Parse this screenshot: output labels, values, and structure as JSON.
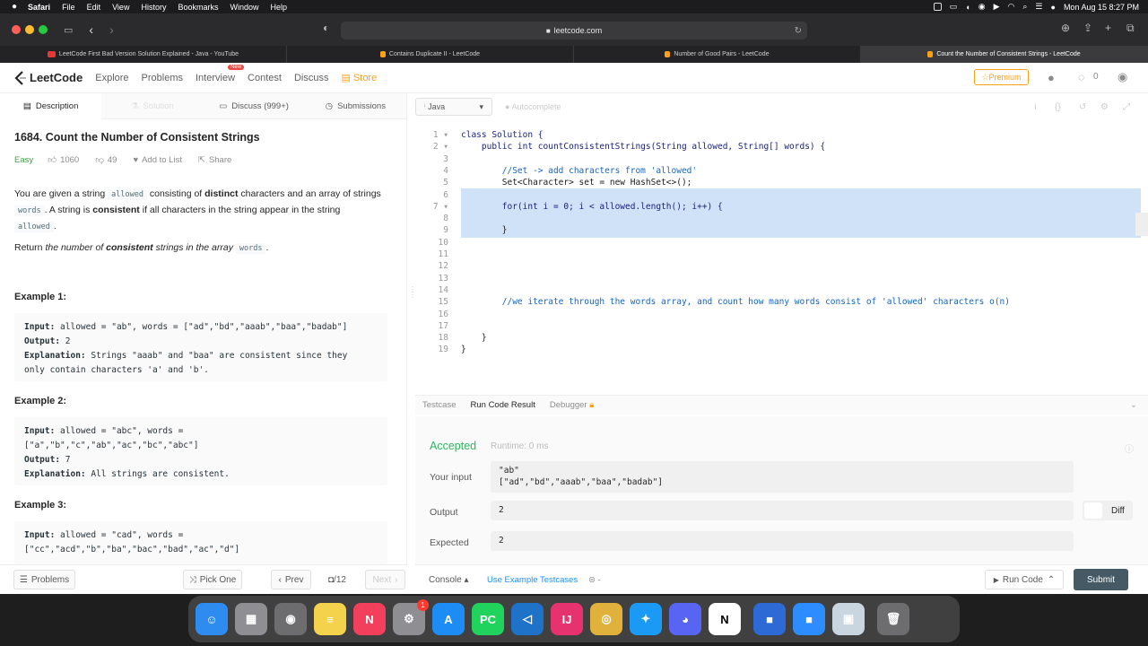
{
  "menubar": {
    "app": "Safari",
    "items": [
      "File",
      "Edit",
      "View",
      "History",
      "Bookmarks",
      "Window",
      "Help"
    ],
    "clock": "Mon Aug 15  8:27 PM"
  },
  "browser": {
    "url": "leetcode.com",
    "tabs": [
      {
        "title": "LeetCode First Bad Version Solution Explained - Java - YouTube",
        "color": "#e53935"
      },
      {
        "title": "Contains Duplicate II - LeetCode",
        "color": "#ffa116"
      },
      {
        "title": "Number of Good Pairs - LeetCode",
        "color": "#ffa116"
      },
      {
        "title": "Count the Number of Consistent Strings - LeetCode",
        "color": "#ffa116"
      }
    ]
  },
  "nav": {
    "logo": "LeetCode",
    "explore": "Explore",
    "problems": "Problems",
    "interview": "Interview",
    "new_badge": "New",
    "contest": "Contest",
    "discuss": "Discuss",
    "store": "Store",
    "premium": "Premium",
    "coins": "0"
  },
  "left_tabs": {
    "description": "Description",
    "solution": "Solution",
    "discuss": "Discuss (999+)",
    "submissions": "Submissions"
  },
  "problem": {
    "title": "1684. Count the Number of Consistent Strings",
    "difficulty": "Easy",
    "likes": "1060",
    "dislikes": "49",
    "add_to_list": "Add to List",
    "share": "Share",
    "p1_a": "You are given a string ",
    "p1_code1": "allowed",
    "p1_b": " consisting of ",
    "p1_bold1": "distinct",
    "p1_c": " characters and an array of strings ",
    "p1_code2": "words",
    "p1_d": ". A string is ",
    "p1_bold2": "consistent",
    "p1_e": " if all characters in the string appear in the string ",
    "p1_code3": "allowed",
    "p1_f": ".",
    "p2_a": "Return ",
    "p2_i1": "the number of ",
    "p2_b": "consistent",
    "p2_i2": " strings in the array ",
    "p2_code": "words",
    "p2_c": ".",
    "examples": [
      {
        "heading": "Example 1:",
        "lines": [
          {
            "k": "Input:",
            "v": " allowed = \"ab\", words = [\"ad\",\"bd\",\"aaab\",\"baa\",\"badab\"]"
          },
          {
            "k": "Output:",
            "v": " 2"
          },
          {
            "k": "Explanation:",
            "v": " Strings \"aaab\" and \"baa\" are consistent since they"
          },
          {
            "k": "",
            "v": "only contain characters 'a' and 'b'."
          }
        ]
      },
      {
        "heading": "Example 2:",
        "lines": [
          {
            "k": "Input:",
            "v": " allowed = \"abc\", words ="
          },
          {
            "k": "",
            "v": "[\"a\",\"b\",\"c\",\"ab\",\"ac\",\"bc\",\"abc\"]"
          },
          {
            "k": "Output:",
            "v": " 7"
          },
          {
            "k": "Explanation:",
            "v": " All strings are consistent."
          }
        ]
      },
      {
        "heading": "Example 3:",
        "lines": [
          {
            "k": "Input:",
            "v": " allowed = \"cad\", words ="
          },
          {
            "k": "",
            "v": "[\"cc\",\"acd\",\"b\",\"ba\",\"bac\",\"bad\",\"ac\",\"d\"]"
          }
        ]
      }
    ]
  },
  "left_bottom": {
    "problems": "Problems",
    "pick_one": "Pick One",
    "prev": "Prev",
    "page": "/12",
    "next": "Next"
  },
  "editor": {
    "language": "Java",
    "autocomplete": "Autocomplete",
    "lines": [
      "class Solution {",
      "    public int countConsistentStrings(String allowed, String[] words) {",
      "",
      "        //Set -> add characters from 'allowed'",
      "        Set<Character> set = new HashSet<>();",
      "",
      "        for(int i = 0; i < allowed.length(); i++) {",
      "",
      "        }",
      "",
      "",
      "",
      "",
      "",
      "        //we iterate through the words array, and count how many words consist of 'allowed' characters o(n)",
      "",
      "",
      "    }",
      "}"
    ]
  },
  "result_tabs": {
    "testcase": "Testcase",
    "run_code_result": "Run Code Result",
    "debugger": "Debugger"
  },
  "result": {
    "status": "Accepted",
    "runtime": "Runtime: 0 ms",
    "your_input_label": "Your input",
    "your_input_1": "\"ab\"",
    "your_input_2": "[\"ad\",\"bd\",\"aaab\",\"baa\",\"badab\"]",
    "output_label": "Output",
    "output": "2",
    "diff": "Diff",
    "expected_label": "Expected",
    "expected": "2"
  },
  "right_bottom": {
    "console": "Console",
    "use_example": "Use Example Testcases",
    "run_code": "Run Code",
    "submit": "Submit"
  },
  "dock": [
    {
      "icon": "finder-icon",
      "color": "#2e8bf0",
      "glyph": "☺"
    },
    {
      "icon": "launchpad-icon",
      "color": "#8e8e93",
      "glyph": "▦"
    },
    {
      "icon": "screenshot-icon",
      "color": "#6d6d70",
      "glyph": "◉"
    },
    {
      "icon": "notes-icon",
      "color": "#f5d24b",
      "glyph": "≡"
    },
    {
      "icon": "news-icon",
      "color": "#f23f5c",
      "glyph": "N"
    },
    {
      "icon": "system-preferences-icon",
      "color": "#8e8e93",
      "glyph": "⚙"
    },
    {
      "icon": "app-store-icon",
      "color": "#1d8df5",
      "glyph": "A"
    },
    {
      "icon": "pycharm-icon",
      "color": "#1fd35c",
      "glyph": "PC"
    },
    {
      "icon": "vscode-icon",
      "color": "#1e73c8",
      "glyph": "◁"
    },
    {
      "icon": "intellij-icon",
      "color": "#e6336f",
      "glyph": "IJ"
    },
    {
      "icon": "chrome-icon",
      "color": "#e0b23b",
      "glyph": "◎"
    },
    {
      "icon": "safari-icon",
      "color": "#1a9af4",
      "glyph": "✦"
    },
    {
      "icon": "discord-icon",
      "color": "#5865f2",
      "glyph": "◕"
    },
    {
      "icon": "notion-icon",
      "color": "#ffffff",
      "glyph": "N"
    },
    {
      "icon": "zoom-video-icon",
      "color": "#2d6ad6",
      "glyph": "■"
    },
    {
      "icon": "zoom-icon",
      "color": "#2d8cff",
      "glyph": "■"
    },
    {
      "icon": "preview-icon",
      "color": "#c9d6e0",
      "glyph": "▣"
    },
    {
      "icon": "trash-icon",
      "color": "#6d6d70",
      "glyph": "🗑"
    }
  ],
  "dock_badge": "1"
}
